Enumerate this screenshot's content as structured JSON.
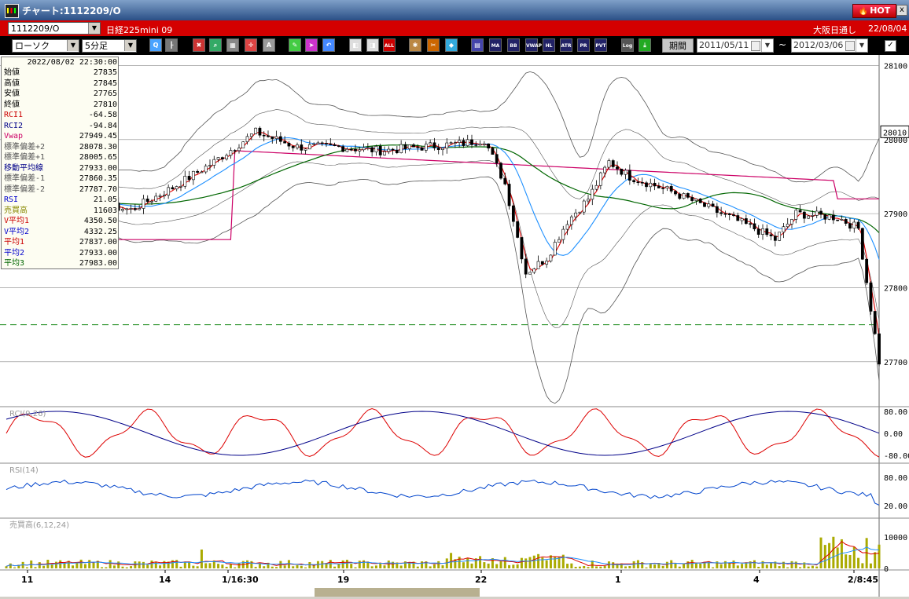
{
  "window": {
    "title": "チャート:1112209/O",
    "hot_label": "HOT",
    "close_label": "x"
  },
  "header": {
    "symbol_code": "1112209/O",
    "symbol_name": "日経225mini 09",
    "market": "大阪日通し",
    "date": "22/08/04"
  },
  "toolbar": {
    "chart_type": "ローソク",
    "interval": "5分足",
    "period_label": "期間",
    "date_from": "2011/05/11",
    "date_to": "2012/03/06",
    "separator": "~",
    "button_texts": {
      "all": "ALL",
      "ma": "MA",
      "bb": "BB",
      "vwap": "VWAP",
      "hl": "HL",
      "atr": "ATR",
      "pr": "PR",
      "pvt": "PVT",
      "log": "Log"
    }
  },
  "info_panel": {
    "datetime": "2022/08/02 22:30:00",
    "rows": [
      {
        "label": "始値",
        "value": "27835",
        "color": "#000000"
      },
      {
        "label": "高値",
        "value": "27845",
        "color": "#000000"
      },
      {
        "label": "安値",
        "value": "27765",
        "color": "#000000"
      },
      {
        "label": "終値",
        "value": "27810",
        "color": "#000000"
      },
      {
        "label": "RCI1",
        "value": "-64.58",
        "color": "#cc0000"
      },
      {
        "label": "RCI2",
        "value": "-94.84",
        "color": "#000088"
      },
      {
        "label": "Vwap",
        "value": "27949.45",
        "color": "#cc0066"
      },
      {
        "label": "標準偏差+2",
        "value": "28078.30",
        "color": "#555555"
      },
      {
        "label": "標準偏差+1",
        "value": "28005.65",
        "color": "#555555"
      },
      {
        "label": "移動平均線",
        "value": "27933.00",
        "color": "#000088"
      },
      {
        "label": "標準偏差-1",
        "value": "27860.35",
        "color": "#555555"
      },
      {
        "label": "標準偏差-2",
        "value": "27787.70",
        "color": "#555555"
      },
      {
        "label": "RSI",
        "value": "21.05",
        "color": "#0000cc"
      },
      {
        "label": "売買高",
        "value": "11603",
        "color": "#888800"
      },
      {
        "label": "V平均1",
        "value": "4350.50",
        "color": "#cc0000"
      },
      {
        "label": "V平均2",
        "value": "4332.25",
        "color": "#0000cc"
      },
      {
        "label": "平均1",
        "value": "27837.00",
        "color": "#cc0000"
      },
      {
        "label": "平均2",
        "value": "27933.00",
        "color": "#0000cc"
      },
      {
        "label": "平均3",
        "value": "27983.00",
        "color": "#006600"
      }
    ]
  },
  "price_axis": {
    "labels": [
      "28100",
      "28000",
      "27900",
      "27800",
      "27700"
    ],
    "current_label": "28010"
  },
  "panels": {
    "rci": {
      "title": "RCI(9,26)",
      "labels": [
        "80.00",
        "0.00",
        "-80.00"
      ]
    },
    "rsi": {
      "title": "RSI(14)",
      "labels": [
        "80.00",
        "20.00"
      ]
    },
    "volume": {
      "title": "売買高(6,12,24)",
      "labels": [
        "10000",
        "0"
      ]
    }
  },
  "time_axis": {
    "labels": [
      "11",
      "14",
      "1/16:30",
      "19",
      "22",
      "1",
      "4",
      "2/8:45"
    ]
  },
  "chart_data": {
    "type": "candlestick",
    "ylim": [
      27650,
      28110
    ],
    "yticks": [
      28100,
      28000,
      27900,
      27800,
      27700
    ],
    "reference_line": 27750,
    "x_labels": [
      "11",
      "14",
      "1/16:30",
      "19",
      "22",
      "1",
      "4",
      "2/8:45"
    ]
  },
  "colors": {
    "background": "#ffffff",
    "grid": "#888888",
    "band": "#555555",
    "ma1": "#dd0000",
    "ma2": "#1e90ff",
    "ma3": "#006600",
    "vwap": "#cc0066",
    "volume_bar": "#aaaa00",
    "rsi": "#0044cc",
    "rci1": "#dd0000",
    "rci2": "#000088"
  }
}
